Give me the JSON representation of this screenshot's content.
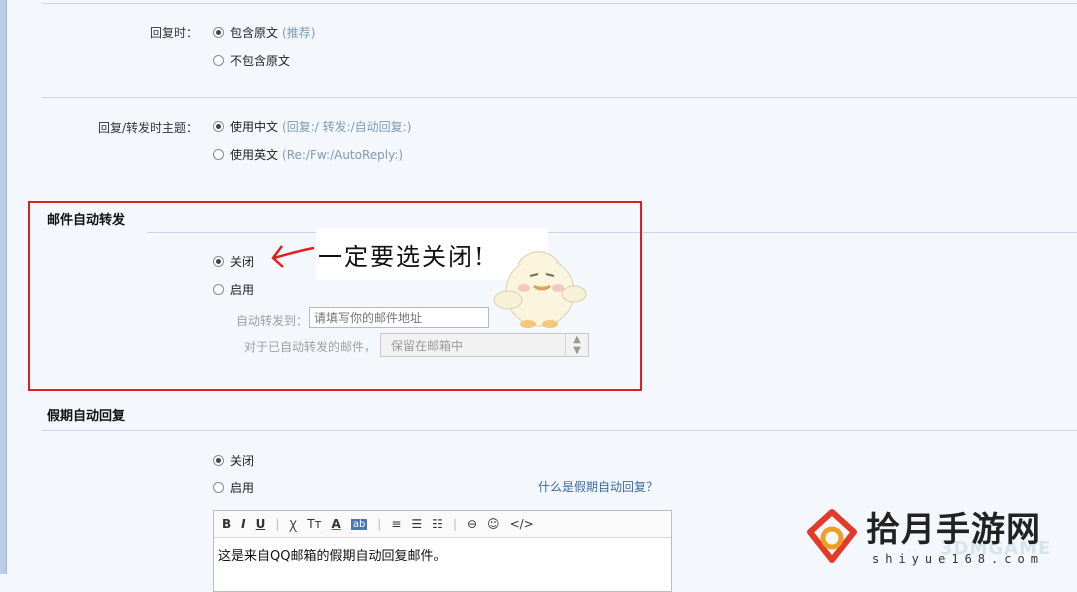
{
  "reply": {
    "label": "回复时：",
    "options": [
      {
        "label": "包含原文",
        "hint": "(推荐)",
        "checked": true
      },
      {
        "label": "不包含原文",
        "hint": "",
        "checked": false
      }
    ]
  },
  "subject": {
    "label": "回复/转发时主题：",
    "options": [
      {
        "label": "使用中文",
        "hint": "(回复:/ 转发:/自动回复:)",
        "checked": true
      },
      {
        "label": "使用英文",
        "hint": "(Re:/Fw:/AutoReply:)",
        "checked": false
      }
    ]
  },
  "forward": {
    "title": "邮件自动转发",
    "options": [
      {
        "label": "关闭",
        "checked": true
      },
      {
        "label": "启用",
        "checked": false
      }
    ],
    "to_label": "自动转发到：",
    "to_placeholder": "请填写你的邮件地址",
    "after_label": "对于已自动转发的邮件，",
    "after_value": "保留在邮箱中",
    "annotation": "一定要选关闭!"
  },
  "vacation": {
    "title": "假期自动回复",
    "options": [
      {
        "label": "关闭",
        "checked": true
      },
      {
        "label": "启用",
        "checked": false
      }
    ],
    "help_link": "什么是假期自动回复？",
    "toolbar": [
      "B",
      "I",
      "U",
      "|",
      "Ꭓ",
      "Tт",
      "A",
      "ab",
      "|",
      "≡",
      "☰",
      "☷",
      "|",
      "⊖",
      "☺",
      "</>"
    ],
    "editor_text": "这是来自QQ邮箱的假期自动回复邮件。"
  },
  "watermark": {
    "title": "拾月手游网",
    "sub": "shiyue168.com",
    "brand": "3DMGAME"
  }
}
